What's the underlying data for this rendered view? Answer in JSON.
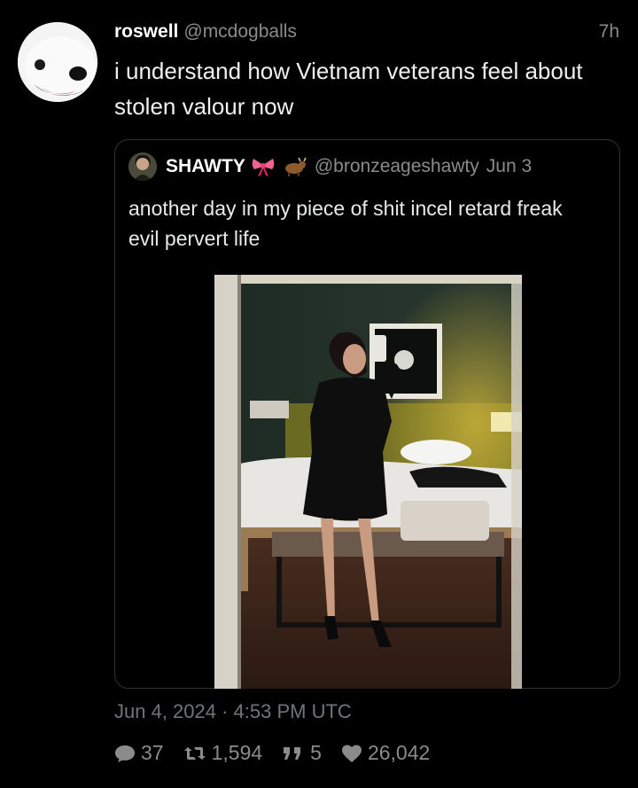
{
  "tweet": {
    "display_name": "roswell",
    "handle": "@mcdogballs",
    "time_ago": "7h",
    "text": "i understand how Vietnam veterans feel about stolen valour now",
    "timestamp": "Jun 4, 2024 · 4:53 PM UTC"
  },
  "quoted_tweet": {
    "display_name": "SHAWTY",
    "emojis": [
      "ribbon-icon",
      "ox-icon"
    ],
    "handle": "@bronzeageshawty",
    "date": "Jun 3",
    "text": "another day in my piece of shit incel retard freak evil pervert life"
  },
  "stats": {
    "replies": "37",
    "retweets": "1,594",
    "quotes": "5",
    "likes": "26,042"
  },
  "colors": {
    "background": "#000000",
    "muted_text": "#8b8b8b",
    "border": "#2f3336"
  }
}
